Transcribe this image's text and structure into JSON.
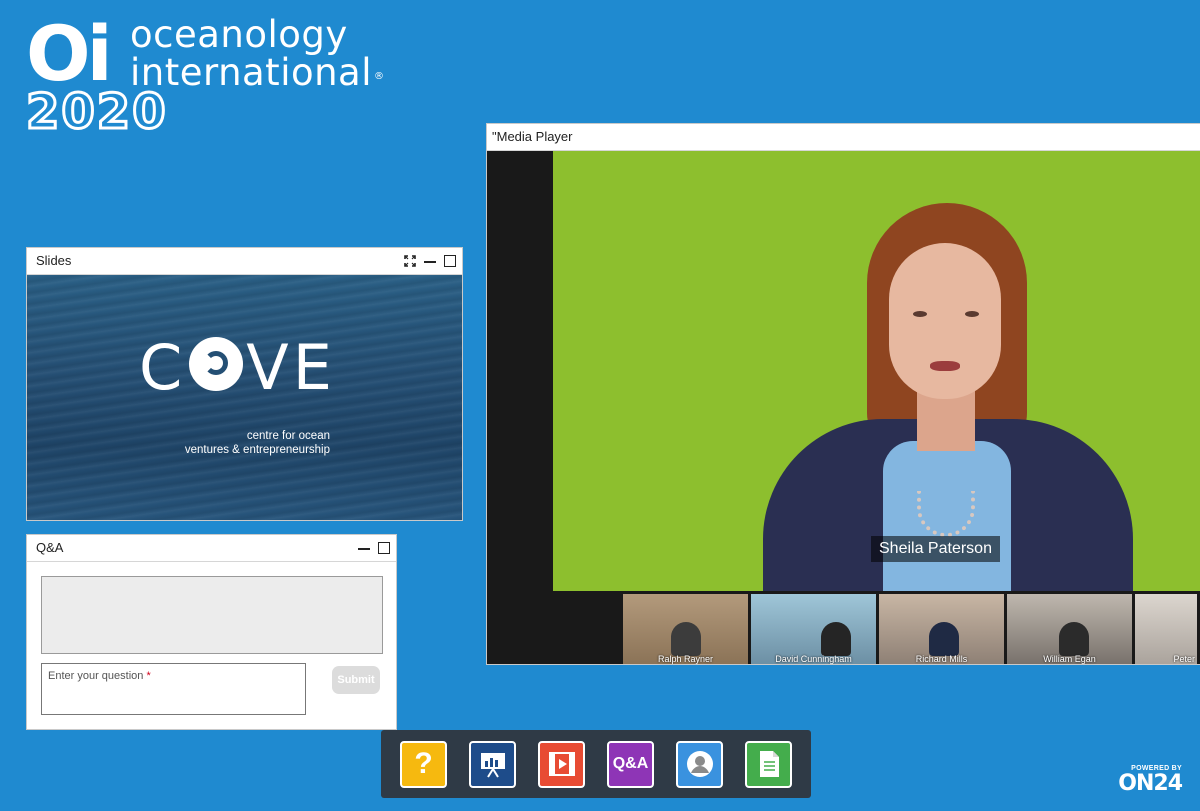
{
  "logo": {
    "mark": "Oi",
    "line1": "oceanology",
    "line2": "international",
    "reg": "®",
    "year": "2020"
  },
  "slides_panel": {
    "title": "Slides",
    "slide": {
      "brand": "COVE",
      "brand_left": "C",
      "brand_right": "VE",
      "subtitle_line1": "centre for ocean",
      "subtitle_line2": "ventures & entrepreneurship"
    }
  },
  "qa_panel": {
    "title": "Q&A",
    "input_placeholder": "Enter your question",
    "required_marker": "*",
    "submit_label": "Submit"
  },
  "media_panel": {
    "title": "Media Player",
    "title_prefix": "\"",
    "speaker_name": "Sheila Paterson",
    "participants": [
      "Ralph Rayner",
      "David Cunningham",
      "Richard Mills",
      "William Egan",
      "Peter"
    ]
  },
  "toolbar": {
    "help_glyph": "?",
    "qa_label": "Q&A",
    "items": [
      "help-icon",
      "slides-icon",
      "media-player-icon",
      "qa-icon",
      "speaker-bio-icon",
      "resources-icon"
    ]
  },
  "powered_by": {
    "prefix": "POWERED BY",
    "brand": "ON24"
  },
  "colors": {
    "background": "#1f8ad0",
    "toolbar_bg": "#2f3a46",
    "help": "#f6b90f",
    "slides": "#1e4c8a",
    "media": "#e84b33",
    "qa": "#8e35b6",
    "speaker": "#3a92df",
    "resources": "#44ad4c",
    "video_green": "#8dbf2e"
  }
}
